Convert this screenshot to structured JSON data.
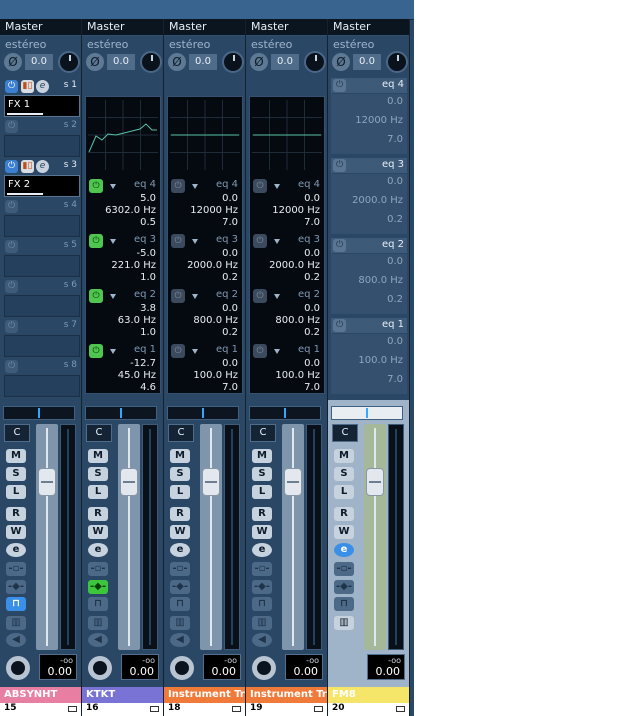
{
  "strips": [
    {
      "output": "Master",
      "mode": "estéreo",
      "pan_value": "0.0",
      "sends": [
        {
          "label": "s 1",
          "name": "FX 1",
          "active": true
        },
        {
          "label": "s 2",
          "name": "",
          "active": false
        },
        {
          "label": "s 3",
          "name": "FX 2",
          "active": true
        },
        {
          "label": "s 4",
          "name": "",
          "active": false
        },
        {
          "label": "s 5",
          "name": "",
          "active": false
        },
        {
          "label": "s 6",
          "name": "",
          "active": false
        },
        {
          "label": "s 7",
          "name": "",
          "active": false
        },
        {
          "label": "s 8",
          "name": "",
          "active": false
        }
      ],
      "pan_display": "C",
      "volume_top": "-oo",
      "volume": "0.00",
      "track_name": "ABSYNHT",
      "track_number": "15",
      "color": "#e87fa3"
    },
    {
      "output": "Master",
      "mode": "estéreo",
      "pan_value": "0.0",
      "eq_bands": [
        {
          "title": "eq 4",
          "on": true,
          "gain": "5.0",
          "freq": "6302.0 Hz",
          "q": "0.5"
        },
        {
          "title": "eq 3",
          "on": true,
          "gain": "-5.0",
          "freq": "221.0 Hz",
          "q": "1.0"
        },
        {
          "title": "eq 2",
          "on": true,
          "gain": "3.8",
          "freq": "63.0 Hz",
          "q": "1.0"
        },
        {
          "title": "eq 1",
          "on": true,
          "gain": "-12.7",
          "freq": "45.0 Hz",
          "q": "4.6"
        }
      ],
      "pan_display": "C",
      "volume_top": "-oo",
      "volume": "0.00",
      "track_name": "KTKT",
      "track_number": "16",
      "color": "#7a73d6"
    },
    {
      "output": "Master",
      "mode": "estéreo",
      "pan_value": "0.0",
      "eq_bands": [
        {
          "title": "eq 4",
          "on": false,
          "gain": "0.0",
          "freq": "12000 Hz",
          "q": "7.0"
        },
        {
          "title": "eq 3",
          "on": false,
          "gain": "0.0",
          "freq": "2000.0 Hz",
          "q": "0.2"
        },
        {
          "title": "eq 2",
          "on": false,
          "gain": "0.0",
          "freq": "800.0 Hz",
          "q": "0.2"
        },
        {
          "title": "eq 1",
          "on": false,
          "gain": "0.0",
          "freq": "100.0 Hz",
          "q": "7.0"
        }
      ],
      "pan_display": "C",
      "volume_top": "-oo",
      "volume": "0.00",
      "track_name": "Instrument Tr",
      "track_number": "18",
      "color": "#f07a3a"
    },
    {
      "output": "Master",
      "mode": "estéreo",
      "pan_value": "0.0",
      "eq_bands": [
        {
          "title": "eq 4",
          "on": false,
          "gain": "0.0",
          "freq": "12000 Hz",
          "q": "7.0"
        },
        {
          "title": "eq 3",
          "on": false,
          "gain": "0.0",
          "freq": "2000.0 Hz",
          "q": "0.2"
        },
        {
          "title": "eq 2",
          "on": false,
          "gain": "0.0",
          "freq": "800.0 Hz",
          "q": "0.2"
        },
        {
          "title": "eq 1",
          "on": false,
          "gain": "0.0",
          "freq": "100.0 Hz",
          "q": "7.0"
        }
      ],
      "pan_display": "C",
      "volume_top": "-oo",
      "volume": "0.00",
      "track_name": "Instrument Tr",
      "track_number": "19",
      "color": "#f07a3a"
    },
    {
      "output": "Master",
      "mode": "estéreo",
      "pan_value": "0.0",
      "eq_bands": [
        {
          "title": "eq 4",
          "on": false,
          "gain": "0.0",
          "freq": "12000 Hz",
          "q": "7.0"
        },
        {
          "title": "eq 3",
          "on": false,
          "gain": "0.0",
          "freq": "2000.0 Hz",
          "q": "0.2"
        },
        {
          "title": "eq 2",
          "on": false,
          "gain": "0.0",
          "freq": "800.0 Hz",
          "q": "0.2"
        },
        {
          "title": "eq 1",
          "on": false,
          "gain": "0.0",
          "freq": "100.0 Hz",
          "q": "7.0"
        }
      ],
      "pan_display": "C",
      "volume_top": "-oo",
      "volume": "0.00",
      "track_name": "FM8",
      "track_number": "20",
      "color": "#f5e66a"
    }
  ],
  "buttons": {
    "mute": "M",
    "solo": "S",
    "listen": "L",
    "read": "R",
    "write": "W",
    "edit": "e",
    "phase_symbol": "Ø",
    "power_symbol": "⏻"
  }
}
